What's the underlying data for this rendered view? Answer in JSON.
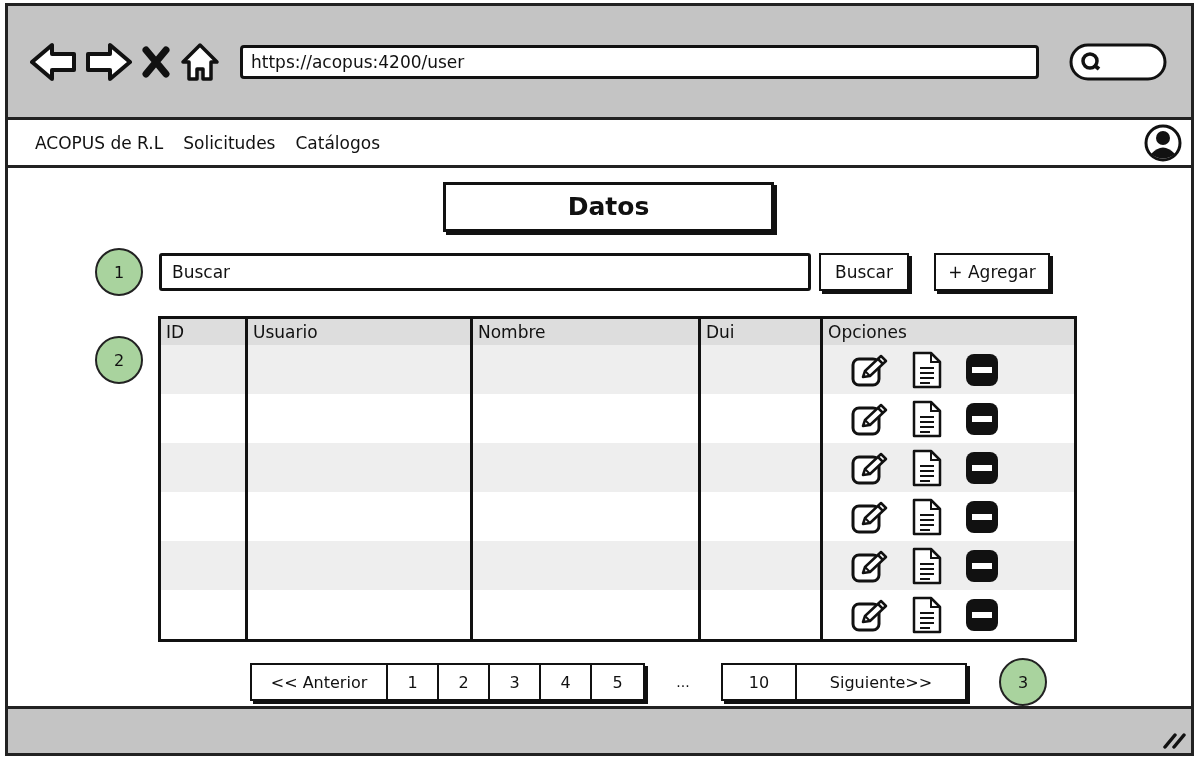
{
  "browser": {
    "url": "https://acopus:4200/user"
  },
  "nav": {
    "items": [
      "ACOPUS de R.L",
      "Solicitudes",
      "Catálogos"
    ]
  },
  "title": "Datos",
  "search": {
    "placeholder": "Buscar",
    "button": "Buscar",
    "add_button": "+ Agregar"
  },
  "callouts": [
    "1",
    "2",
    "3"
  ],
  "table": {
    "columns": [
      "ID",
      "Usuario",
      "Nombre",
      "Dui",
      "Opciones"
    ],
    "rows": [
      {
        "options": [
          {
            "kind": "edit"
          },
          {
            "kind": "document"
          },
          {
            "kind": "remove"
          }
        ]
      },
      {
        "options": [
          {
            "kind": "edit"
          },
          {
            "kind": "document"
          },
          {
            "kind": "remove"
          }
        ]
      },
      {
        "options": [
          {
            "kind": "edit"
          },
          {
            "kind": "document"
          },
          {
            "kind": "remove"
          }
        ]
      },
      {
        "options": [
          {
            "kind": "edit"
          },
          {
            "kind": "document"
          },
          {
            "kind": "remove"
          }
        ]
      },
      {
        "options": [
          {
            "kind": "edit"
          },
          {
            "kind": "document"
          },
          {
            "kind": "remove"
          }
        ]
      },
      {
        "options": [
          {
            "kind": "edit"
          },
          {
            "kind": "document"
          },
          {
            "kind": "remove"
          }
        ]
      }
    ]
  },
  "pagination": {
    "previous": "<< Anterior",
    "pages": [
      {
        "label": "1",
        "selected": false
      },
      {
        "label": "2",
        "selected": false
      },
      {
        "label": "3",
        "selected": false
      },
      {
        "label": "4",
        "selected": false
      },
      {
        "label": "5",
        "selected": false
      }
    ],
    "ellipsis": "...",
    "last": {
      "label": "10",
      "selected": false
    },
    "next": "Siguiente>>"
  }
}
